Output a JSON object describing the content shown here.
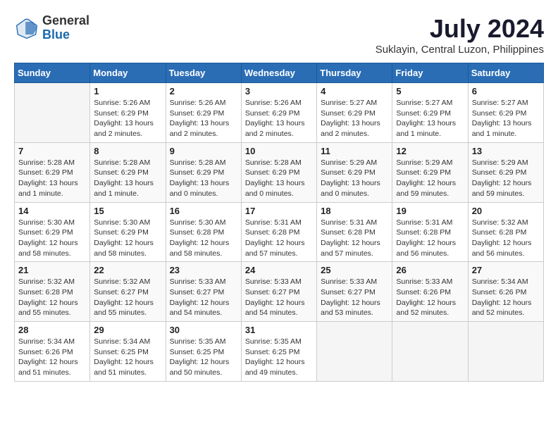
{
  "logo": {
    "general": "General",
    "blue": "Blue"
  },
  "title": "July 2024",
  "subtitle": "Suklayin, Central Luzon, Philippines",
  "days_of_week": [
    "Sunday",
    "Monday",
    "Tuesday",
    "Wednesday",
    "Thursday",
    "Friday",
    "Saturday"
  ],
  "weeks": [
    [
      {
        "day": "",
        "detail": ""
      },
      {
        "day": "1",
        "detail": "Sunrise: 5:26 AM\nSunset: 6:29 PM\nDaylight: 13 hours and 2 minutes."
      },
      {
        "day": "2",
        "detail": "Sunrise: 5:26 AM\nSunset: 6:29 PM\nDaylight: 13 hours and 2 minutes."
      },
      {
        "day": "3",
        "detail": "Sunrise: 5:26 AM\nSunset: 6:29 PM\nDaylight: 13 hours and 2 minutes."
      },
      {
        "day": "4",
        "detail": "Sunrise: 5:27 AM\nSunset: 6:29 PM\nDaylight: 13 hours and 2 minutes."
      },
      {
        "day": "5",
        "detail": "Sunrise: 5:27 AM\nSunset: 6:29 PM\nDaylight: 13 hours and 1 minute."
      },
      {
        "day": "6",
        "detail": "Sunrise: 5:27 AM\nSunset: 6:29 PM\nDaylight: 13 hours and 1 minute."
      }
    ],
    [
      {
        "day": "7",
        "detail": "Sunrise: 5:28 AM\nSunset: 6:29 PM\nDaylight: 13 hours and 1 minute."
      },
      {
        "day": "8",
        "detail": "Sunrise: 5:28 AM\nSunset: 6:29 PM\nDaylight: 13 hours and 1 minute."
      },
      {
        "day": "9",
        "detail": "Sunrise: 5:28 AM\nSunset: 6:29 PM\nDaylight: 13 hours and 0 minutes."
      },
      {
        "day": "10",
        "detail": "Sunrise: 5:28 AM\nSunset: 6:29 PM\nDaylight: 13 hours and 0 minutes."
      },
      {
        "day": "11",
        "detail": "Sunrise: 5:29 AM\nSunset: 6:29 PM\nDaylight: 13 hours and 0 minutes."
      },
      {
        "day": "12",
        "detail": "Sunrise: 5:29 AM\nSunset: 6:29 PM\nDaylight: 12 hours and 59 minutes."
      },
      {
        "day": "13",
        "detail": "Sunrise: 5:29 AM\nSunset: 6:29 PM\nDaylight: 12 hours and 59 minutes."
      }
    ],
    [
      {
        "day": "14",
        "detail": "Sunrise: 5:30 AM\nSunset: 6:29 PM\nDaylight: 12 hours and 58 minutes."
      },
      {
        "day": "15",
        "detail": "Sunrise: 5:30 AM\nSunset: 6:29 PM\nDaylight: 12 hours and 58 minutes."
      },
      {
        "day": "16",
        "detail": "Sunrise: 5:30 AM\nSunset: 6:28 PM\nDaylight: 12 hours and 58 minutes."
      },
      {
        "day": "17",
        "detail": "Sunrise: 5:31 AM\nSunset: 6:28 PM\nDaylight: 12 hours and 57 minutes."
      },
      {
        "day": "18",
        "detail": "Sunrise: 5:31 AM\nSunset: 6:28 PM\nDaylight: 12 hours and 57 minutes."
      },
      {
        "day": "19",
        "detail": "Sunrise: 5:31 AM\nSunset: 6:28 PM\nDaylight: 12 hours and 56 minutes."
      },
      {
        "day": "20",
        "detail": "Sunrise: 5:32 AM\nSunset: 6:28 PM\nDaylight: 12 hours and 56 minutes."
      }
    ],
    [
      {
        "day": "21",
        "detail": "Sunrise: 5:32 AM\nSunset: 6:28 PM\nDaylight: 12 hours and 55 minutes."
      },
      {
        "day": "22",
        "detail": "Sunrise: 5:32 AM\nSunset: 6:27 PM\nDaylight: 12 hours and 55 minutes."
      },
      {
        "day": "23",
        "detail": "Sunrise: 5:33 AM\nSunset: 6:27 PM\nDaylight: 12 hours and 54 minutes."
      },
      {
        "day": "24",
        "detail": "Sunrise: 5:33 AM\nSunset: 6:27 PM\nDaylight: 12 hours and 54 minutes."
      },
      {
        "day": "25",
        "detail": "Sunrise: 5:33 AM\nSunset: 6:27 PM\nDaylight: 12 hours and 53 minutes."
      },
      {
        "day": "26",
        "detail": "Sunrise: 5:33 AM\nSunset: 6:26 PM\nDaylight: 12 hours and 52 minutes."
      },
      {
        "day": "27",
        "detail": "Sunrise: 5:34 AM\nSunset: 6:26 PM\nDaylight: 12 hours and 52 minutes."
      }
    ],
    [
      {
        "day": "28",
        "detail": "Sunrise: 5:34 AM\nSunset: 6:26 PM\nDaylight: 12 hours and 51 minutes."
      },
      {
        "day": "29",
        "detail": "Sunrise: 5:34 AM\nSunset: 6:25 PM\nDaylight: 12 hours and 51 minutes."
      },
      {
        "day": "30",
        "detail": "Sunrise: 5:35 AM\nSunset: 6:25 PM\nDaylight: 12 hours and 50 minutes."
      },
      {
        "day": "31",
        "detail": "Sunrise: 5:35 AM\nSunset: 6:25 PM\nDaylight: 12 hours and 49 minutes."
      },
      {
        "day": "",
        "detail": ""
      },
      {
        "day": "",
        "detail": ""
      },
      {
        "day": "",
        "detail": ""
      }
    ]
  ]
}
